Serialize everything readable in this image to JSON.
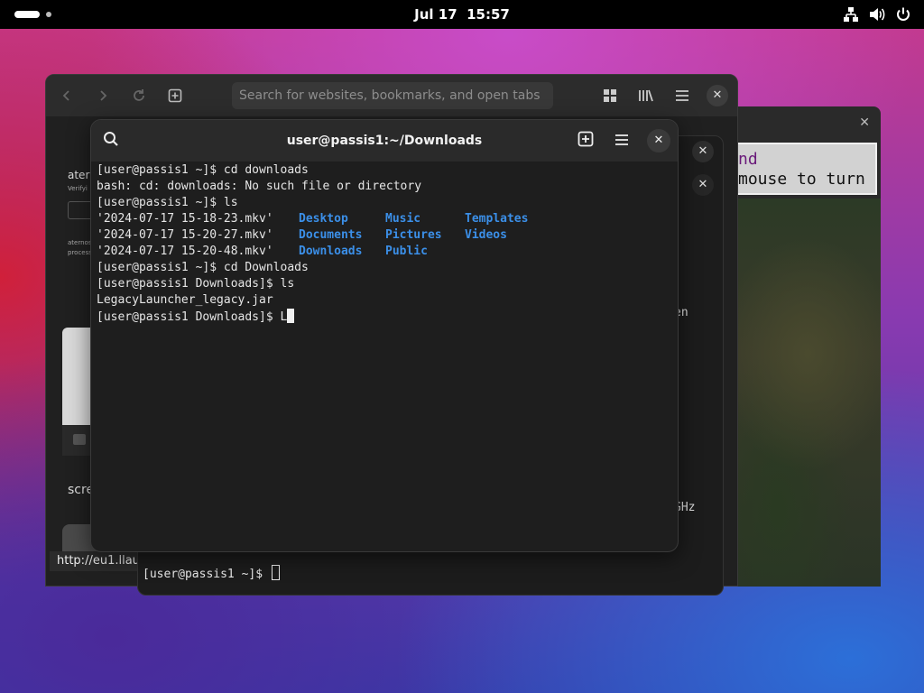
{
  "topbar": {
    "date": "Jul 17",
    "time": "15:57",
    "tray_icons": [
      "network-icon",
      "volume-icon",
      "power-icon"
    ]
  },
  "browser": {
    "search_placeholder": "Search for websites, bookmarks, and open tabs",
    "page_text_1": "atern",
    "page_text_2": "Verifyi",
    "page_text_3": "aternos",
    "page_text_4": "process",
    "page_label_scre": "scre",
    "status_url": "http://eu1.llau",
    "partial_en": "en",
    "partial_ghz": "GHz"
  },
  "game": {
    "line1": "nd",
    "line2": "mouse to turn"
  },
  "terminal2": {
    "prompt": "[user@passis1 ~]$ "
  },
  "terminal": {
    "title": "user@passis1:~/Downloads",
    "lines": {
      "l1": "[user@passis1 ~]$ cd downloads",
      "l2": "bash: cd: downloads: No such file or directory",
      "l3": "[user@passis1 ~]$ ls",
      "l7": "[user@passis1 ~]$ cd Downloads",
      "l8": "[user@passis1 Downloads]$ ls",
      "l9": "LegacyLauncher_legacy.jar",
      "l10": "[user@passis1 Downloads]$ L"
    },
    "ls_rows": [
      {
        "file": "'2024-07-17 15-18-23.mkv'",
        "d1": "Desktop",
        "d2": "Music",
        "d3": "Templates"
      },
      {
        "file": "'2024-07-17 15-20-27.mkv'",
        "d1": "Documents",
        "d2": "Pictures",
        "d3": "Videos"
      },
      {
        "file": "'2024-07-17 15-20-48.mkv'",
        "d1": "Downloads",
        "d2": "Public",
        "d3": ""
      }
    ]
  },
  "colors": {
    "directory": "#3b8fe8",
    "terminal_bg": "#1e1e1e",
    "header_bg": "#2a2a2a"
  }
}
